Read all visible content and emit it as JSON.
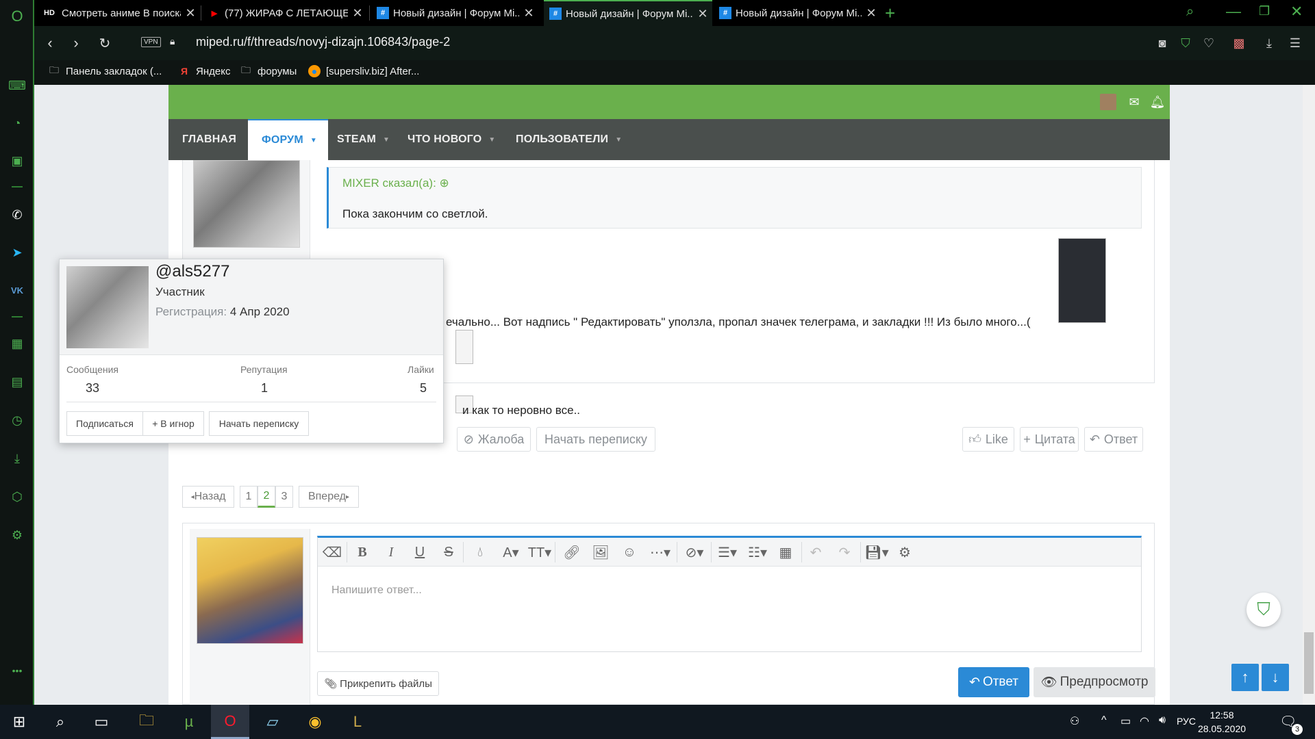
{
  "browser": {
    "tabs": [
      {
        "label": "Смотреть аниме В поиска...",
        "fav": "HD",
        "fav_color": "#ffffff"
      },
      {
        "label": "(77) ЖИРАФ С ЛЕТАЮЩЕЙ...",
        "fav": "▶",
        "fav_color": "#ff0000"
      },
      {
        "label": "Новый дизайн | Форум Mi...",
        "fav": "#",
        "fav_color": "#1e88e5"
      },
      {
        "label": "Новый дизайн | Форум Mi...",
        "fav": "#",
        "fav_color": "#1e88e5"
      },
      {
        "label": "Новый дизайн | Форум Mi...",
        "fav": "#",
        "fav_color": "#1e88e5"
      }
    ],
    "new_tab": "+",
    "vpn": "VPN",
    "url": "miped.ru/f/threads/novyj-dizajn.106843/page-2",
    "bookmarks": [
      {
        "label": "Панель закладок (...",
        "icon": "folder-icon"
      },
      {
        "label": "Яндекс",
        "icon": "yandex-icon"
      },
      {
        "label": "форумы",
        "icon": "folder-icon"
      },
      {
        "label": "[supersliv.biz] After...",
        "icon": "site-icon"
      }
    ]
  },
  "nav": {
    "items": [
      {
        "label": "ГЛАВНАЯ"
      },
      {
        "label": "ФОРУМ"
      },
      {
        "label": "STEAM"
      },
      {
        "label": "ЧТО НОВОГО"
      },
      {
        "label": "ПОЛЬЗОВАТЕЛИ"
      }
    ]
  },
  "post": {
    "quote_author": "MIXER сказал(а):",
    "quote_text": "Пока закончим со светлой.",
    "text1": "ечально... Вот надпись \" Редактировать\" уползла, пропал значек телеграма, и закладки !!! Из было много...(",
    "text2": "и как то неровно все..",
    "report": "Жалоба",
    "start_conv": "Начать переписку",
    "like": "Like",
    "quote_btn": "Цитата",
    "reply_btn": "Ответ"
  },
  "pager": {
    "prev": "Назад",
    "pages": [
      "1",
      "2",
      "3"
    ],
    "current": "2",
    "next": "Вперед"
  },
  "editor": {
    "placeholder": "Напишите ответ...",
    "attach": "Прикрепить файлы",
    "submit": "Ответ",
    "preview": "Предпросмотр"
  },
  "tooltip": {
    "username": "@als5277",
    "role": "Участник",
    "reg_label": "Регистрация:",
    "reg_date": "4 Апр 2020",
    "messages_label": "Сообщения",
    "messages": "33",
    "reputation_label": "Репутация",
    "reputation": "1",
    "likes_label": "Лайки",
    "likes": "5",
    "subscribe": "Подписаться",
    "ignore": "+ В игнор",
    "conversation": "Начать переписку"
  },
  "taskbar": {
    "lang": "РУС",
    "time": "12:58",
    "date": "28.05.2020",
    "notif_count": "3"
  }
}
